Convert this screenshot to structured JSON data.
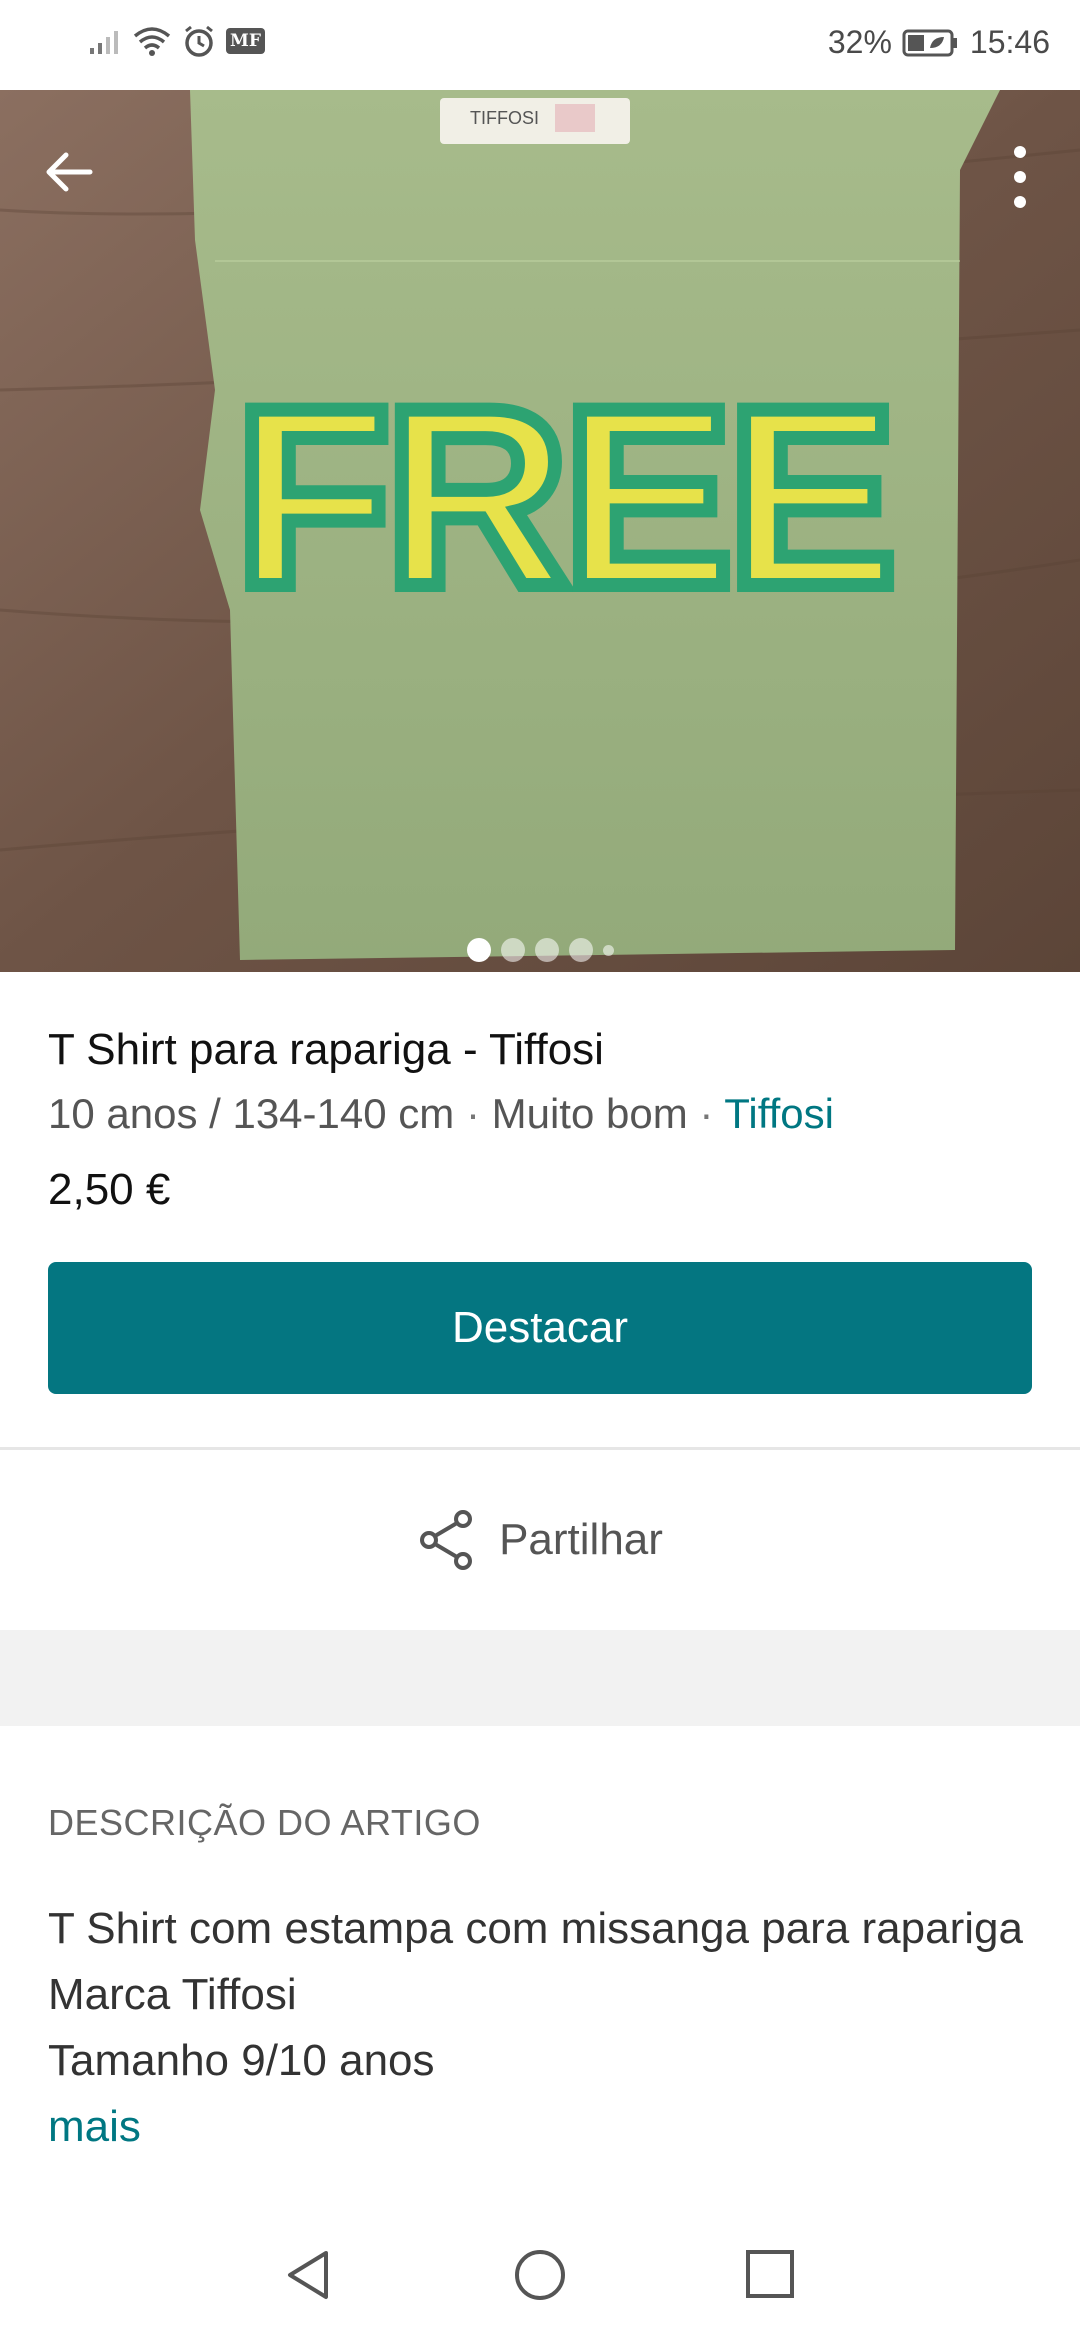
{
  "status_bar": {
    "carrier_badge": "MF",
    "battery": "32%",
    "time": "15:46"
  },
  "colors": {
    "accent": "#047681",
    "link": "#007782"
  },
  "icons": {
    "back": "arrow-left-icon",
    "more": "more-vertical-icon",
    "share": "share-icon"
  },
  "gallery": {
    "image_count": 5,
    "active_index": 0,
    "tag_text": "TIFFOSI",
    "print_text": "FREE"
  },
  "item": {
    "title": "T Shirt para rapariga - Tiffosi",
    "size": "10 anos / 134-140 cm",
    "separator": "·",
    "condition": "Muito bom",
    "brand": "Tiffosi",
    "price": "2,50 €"
  },
  "actions": {
    "promote_label": "Destacar",
    "share_label": "Partilhar"
  },
  "description": {
    "heading": "DESCRIÇÃO DO ARTIGO",
    "lines": [
      "T Shirt com estampa com missanga para rapariga",
      "Marca Tiffosi",
      "Tamanho 9/10 anos"
    ],
    "more_label": "mais"
  }
}
